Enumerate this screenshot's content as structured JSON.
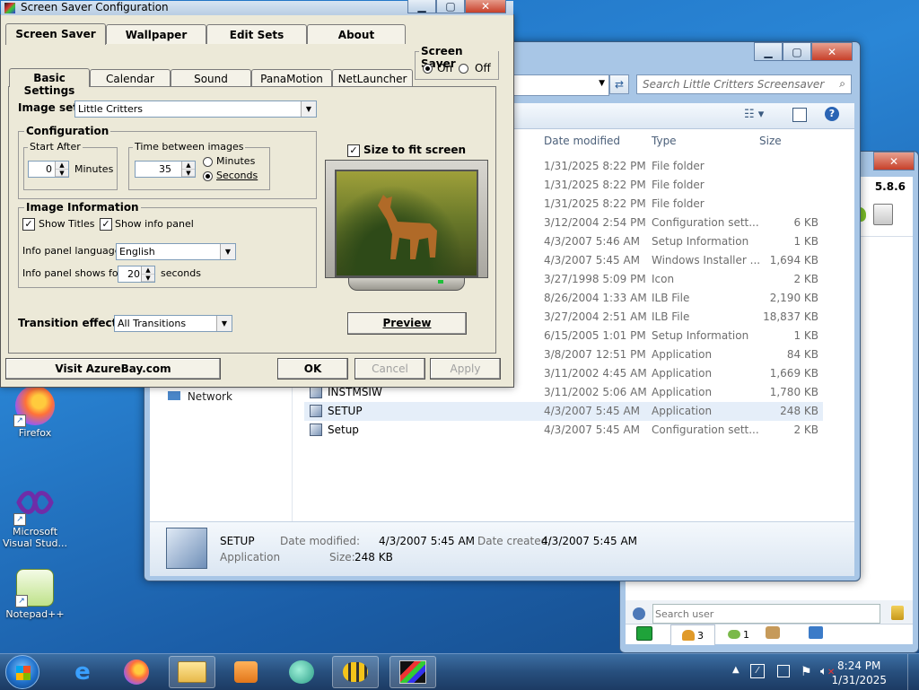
{
  "desktop": {
    "icons": [
      {
        "label": "Firefox"
      },
      {
        "label": "Microsoft Visual Stud..."
      },
      {
        "label": "Notepad++"
      }
    ]
  },
  "explorer": {
    "search_placeholder": "Search Little Critters Screensaver",
    "columns": {
      "date": "Date modified",
      "type": "Type",
      "size": "Size"
    },
    "nav_network": "Network",
    "rows": [
      {
        "name": "",
        "date": "1/31/2025 8:22 PM",
        "type": "File folder",
        "size": ""
      },
      {
        "name": "",
        "date": "1/31/2025 8:22 PM",
        "type": "File folder",
        "size": ""
      },
      {
        "name": "",
        "date": "1/31/2025 8:22 PM",
        "type": "File folder",
        "size": ""
      },
      {
        "name": "",
        "date": "3/12/2004 2:54 PM",
        "type": "Configuration sett...",
        "size": "6 KB"
      },
      {
        "name": "",
        "date": "4/3/2007 5:46 AM",
        "type": "Setup Information",
        "size": "1 KB"
      },
      {
        "name": "",
        "date": "4/3/2007 5:45 AM",
        "type": "Windows Installer ...",
        "size": "1,694 KB"
      },
      {
        "name": "",
        "date": "3/27/1998 5:09 PM",
        "type": "Icon",
        "size": "2 KB"
      },
      {
        "name": "",
        "date": "8/26/2004 1:33 AM",
        "type": "ILB File",
        "size": "2,190 KB"
      },
      {
        "name": "",
        "date": "3/27/2004 2:51 AM",
        "type": "ILB File",
        "size": "18,837 KB"
      },
      {
        "name": "",
        "date": "6/15/2005 1:01 PM",
        "type": "Setup Information",
        "size": "1 KB"
      },
      {
        "name": "",
        "date": "3/8/2007 12:51 PM",
        "type": "Application",
        "size": "84 KB"
      },
      {
        "name": "",
        "date": "3/11/2002 4:45 AM",
        "type": "Application",
        "size": "1,669 KB"
      },
      {
        "name": "INSTMSIW",
        "date": "3/11/2002 5:06 AM",
        "type": "Application",
        "size": "1,780 KB"
      },
      {
        "name": "SETUP",
        "date": "4/3/2007 5:45 AM",
        "type": "Application",
        "size": "248 KB"
      },
      {
        "name": "Setup",
        "date": "4/3/2007 5:45 AM",
        "type": "Configuration sett...",
        "size": "2 KB"
      }
    ],
    "details": {
      "name": "SETUP",
      "kind": "Application",
      "modified_label": "Date modified:",
      "modified": "4/3/2007 5:45 AM",
      "created_label": "Date created:",
      "created": "4/3/2007 5:45 AM",
      "size_label": "Size:",
      "size": "248 KB"
    }
  },
  "chat_window": {
    "version": "5.8.6",
    "search_placeholder": "Search user",
    "tabs": [
      {
        "count": "3"
      },
      {
        "count": "1"
      }
    ]
  },
  "ssconfig": {
    "title": "Screen Saver Configuration",
    "top_tabs": [
      "Screen Saver",
      "Wallpaper",
      "Edit Sets",
      "About"
    ],
    "screensaver_group": "Screen Saver",
    "on_label": "On",
    "off_label": "Off",
    "sub_tabs": [
      "Basic Settings",
      "Calendar",
      "Sound",
      "PanaMotion",
      "NetLauncher"
    ],
    "image_set_label": "Image set:",
    "image_set_value": "Little Critters",
    "configuration_label": "Configuration",
    "start_after_label": "Start After",
    "start_after_value": "0",
    "minutes_label": "Minutes",
    "time_between_label": "Time between images",
    "time_between_value": "35",
    "radio_minutes": "Minutes",
    "radio_seconds": "Seconds",
    "size_to_fit": "Size to fit screen",
    "image_info_label": "Image Information",
    "show_titles": "Show Titles",
    "show_info_panel": "Show info panel",
    "info_lang_label": "Info panel language:",
    "info_lang_value": "English",
    "info_shows_label": "Info panel shows for:",
    "info_shows_value": "20",
    "seconds_label": "seconds",
    "transition_label": "Transition effects:",
    "transition_value": "All Transitions",
    "preview": "Preview",
    "visit": "Visit AzureBay.com",
    "ok": "OK",
    "cancel": "Cancel",
    "apply": "Apply"
  },
  "taskbar": {
    "time": "8:24 PM",
    "date": "1/31/2025"
  }
}
